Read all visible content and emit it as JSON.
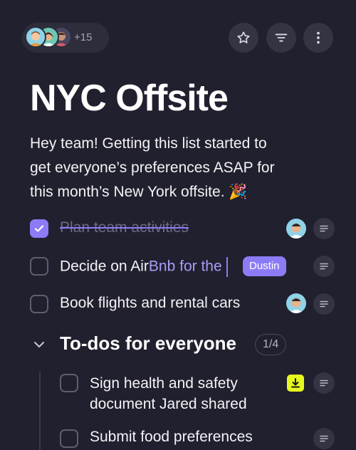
{
  "header": {
    "collaborators_more": "+15",
    "actions": [
      {
        "icon": "star-icon"
      },
      {
        "icon": "filter-icon"
      },
      {
        "icon": "more-vertical-icon"
      }
    ]
  },
  "page": {
    "title": "NYC Offsite",
    "description_line1": "Hey team! Getting this list started to",
    "description_line2": "get everyone’s preferences ASAP for",
    "description_line3": "this month’s New York offsite. 🎉"
  },
  "tasks": [
    {
      "text": "Plan team activities",
      "done": true
    },
    {
      "text_normal": "Decide on Air",
      "text_typing": "Bnb for the",
      "cursor_tag": "Dustin",
      "done": false
    },
    {
      "text": "Book flights and rental cars",
      "done": false
    }
  ],
  "section": {
    "title": "To-dos for everyone",
    "count": "1/4",
    "items": [
      {
        "line1": "Sign health and safety",
        "line2": "document Jared shared",
        "done": false
      },
      {
        "text": "Submit food preferences",
        "done": false
      }
    ]
  },
  "colors": {
    "background": "#21202e",
    "accent": "#8b7cf6",
    "download_badge": "#e6f91f"
  }
}
